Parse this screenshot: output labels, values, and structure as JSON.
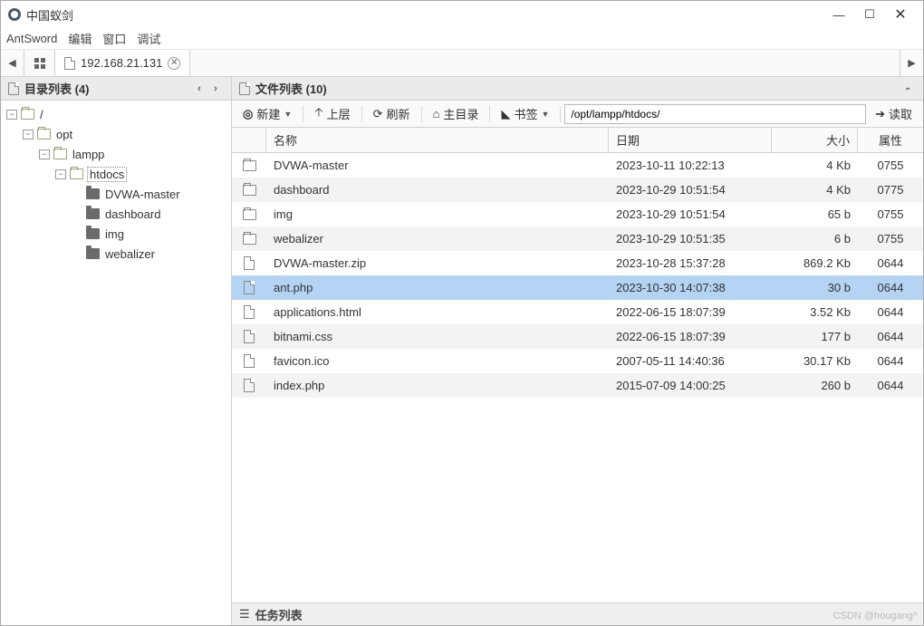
{
  "window": {
    "title": "中国蚁剑"
  },
  "menu": {
    "items": [
      "AntSword",
      "编辑",
      "窗口",
      "调试"
    ]
  },
  "tab": {
    "label": "192.168.21.131"
  },
  "sidebar": {
    "header": "目录列表 (4)",
    "tree": [
      {
        "indent": 0,
        "tw": "−",
        "label": "/",
        "icon": "open",
        "sel": false
      },
      {
        "indent": 1,
        "tw": "−",
        "label": "opt",
        "icon": "open",
        "sel": false
      },
      {
        "indent": 2,
        "tw": "−",
        "label": "lampp",
        "icon": "open",
        "sel": false
      },
      {
        "indent": 3,
        "tw": "−",
        "label": "htdocs",
        "icon": "open",
        "sel": true
      },
      {
        "indent": 4,
        "tw": "",
        "label": "DVWA-master",
        "icon": "solid",
        "sel": false
      },
      {
        "indent": 4,
        "tw": "",
        "label": "dashboard",
        "icon": "solid",
        "sel": false
      },
      {
        "indent": 4,
        "tw": "",
        "label": "img",
        "icon": "solid",
        "sel": false
      },
      {
        "indent": 4,
        "tw": "",
        "label": "webalizer",
        "icon": "solid",
        "sel": false
      }
    ]
  },
  "content": {
    "header": "文件列表 (10)",
    "toolbar": {
      "new": "新建",
      "up": "上层",
      "refresh": "刷新",
      "home": "主目录",
      "bookmark": "书签",
      "path": "/opt/lampp/htdocs/",
      "read": "读取"
    },
    "columns": {
      "name": "名称",
      "date": "日期",
      "size": "大小",
      "attr": "属性"
    },
    "rows": [
      {
        "icon": "folder",
        "name": "DVWA-master",
        "date": "2023-10-11 10:22:13",
        "size": "4 Kb",
        "attr": "0755",
        "sel": false
      },
      {
        "icon": "folder",
        "name": "dashboard",
        "date": "2023-10-29 10:51:54",
        "size": "4 Kb",
        "attr": "0775",
        "sel": false
      },
      {
        "icon": "folder",
        "name": "img",
        "date": "2023-10-29 10:51:54",
        "size": "65 b",
        "attr": "0755",
        "sel": false
      },
      {
        "icon": "folder",
        "name": "webalizer",
        "date": "2023-10-29 10:51:35",
        "size": "6 b",
        "attr": "0755",
        "sel": false
      },
      {
        "icon": "file",
        "name": "DVWA-master.zip",
        "date": "2023-10-28 15:37:28",
        "size": "869.2 Kb",
        "attr": "0644",
        "sel": false
      },
      {
        "icon": "file",
        "name": "ant.php",
        "date": "2023-10-30 14:07:38",
        "size": "30 b",
        "attr": "0644",
        "sel": true
      },
      {
        "icon": "file",
        "name": "applications.html",
        "date": "2022-06-15 18:07:39",
        "size": "3.52 Kb",
        "attr": "0644",
        "sel": false
      },
      {
        "icon": "file",
        "name": "bitnami.css",
        "date": "2022-06-15 18:07:39",
        "size": "177 b",
        "attr": "0644",
        "sel": false
      },
      {
        "icon": "file",
        "name": "favicon.ico",
        "date": "2007-05-11 14:40:36",
        "size": "30.17 Kb",
        "attr": "0644",
        "sel": false
      },
      {
        "icon": "file",
        "name": "index.php",
        "date": "2015-07-09 14:00:25",
        "size": "260 b",
        "attr": "0644",
        "sel": false
      }
    ]
  },
  "tasks": {
    "header": "任务列表"
  },
  "watermark": "CSDN @hougang^"
}
